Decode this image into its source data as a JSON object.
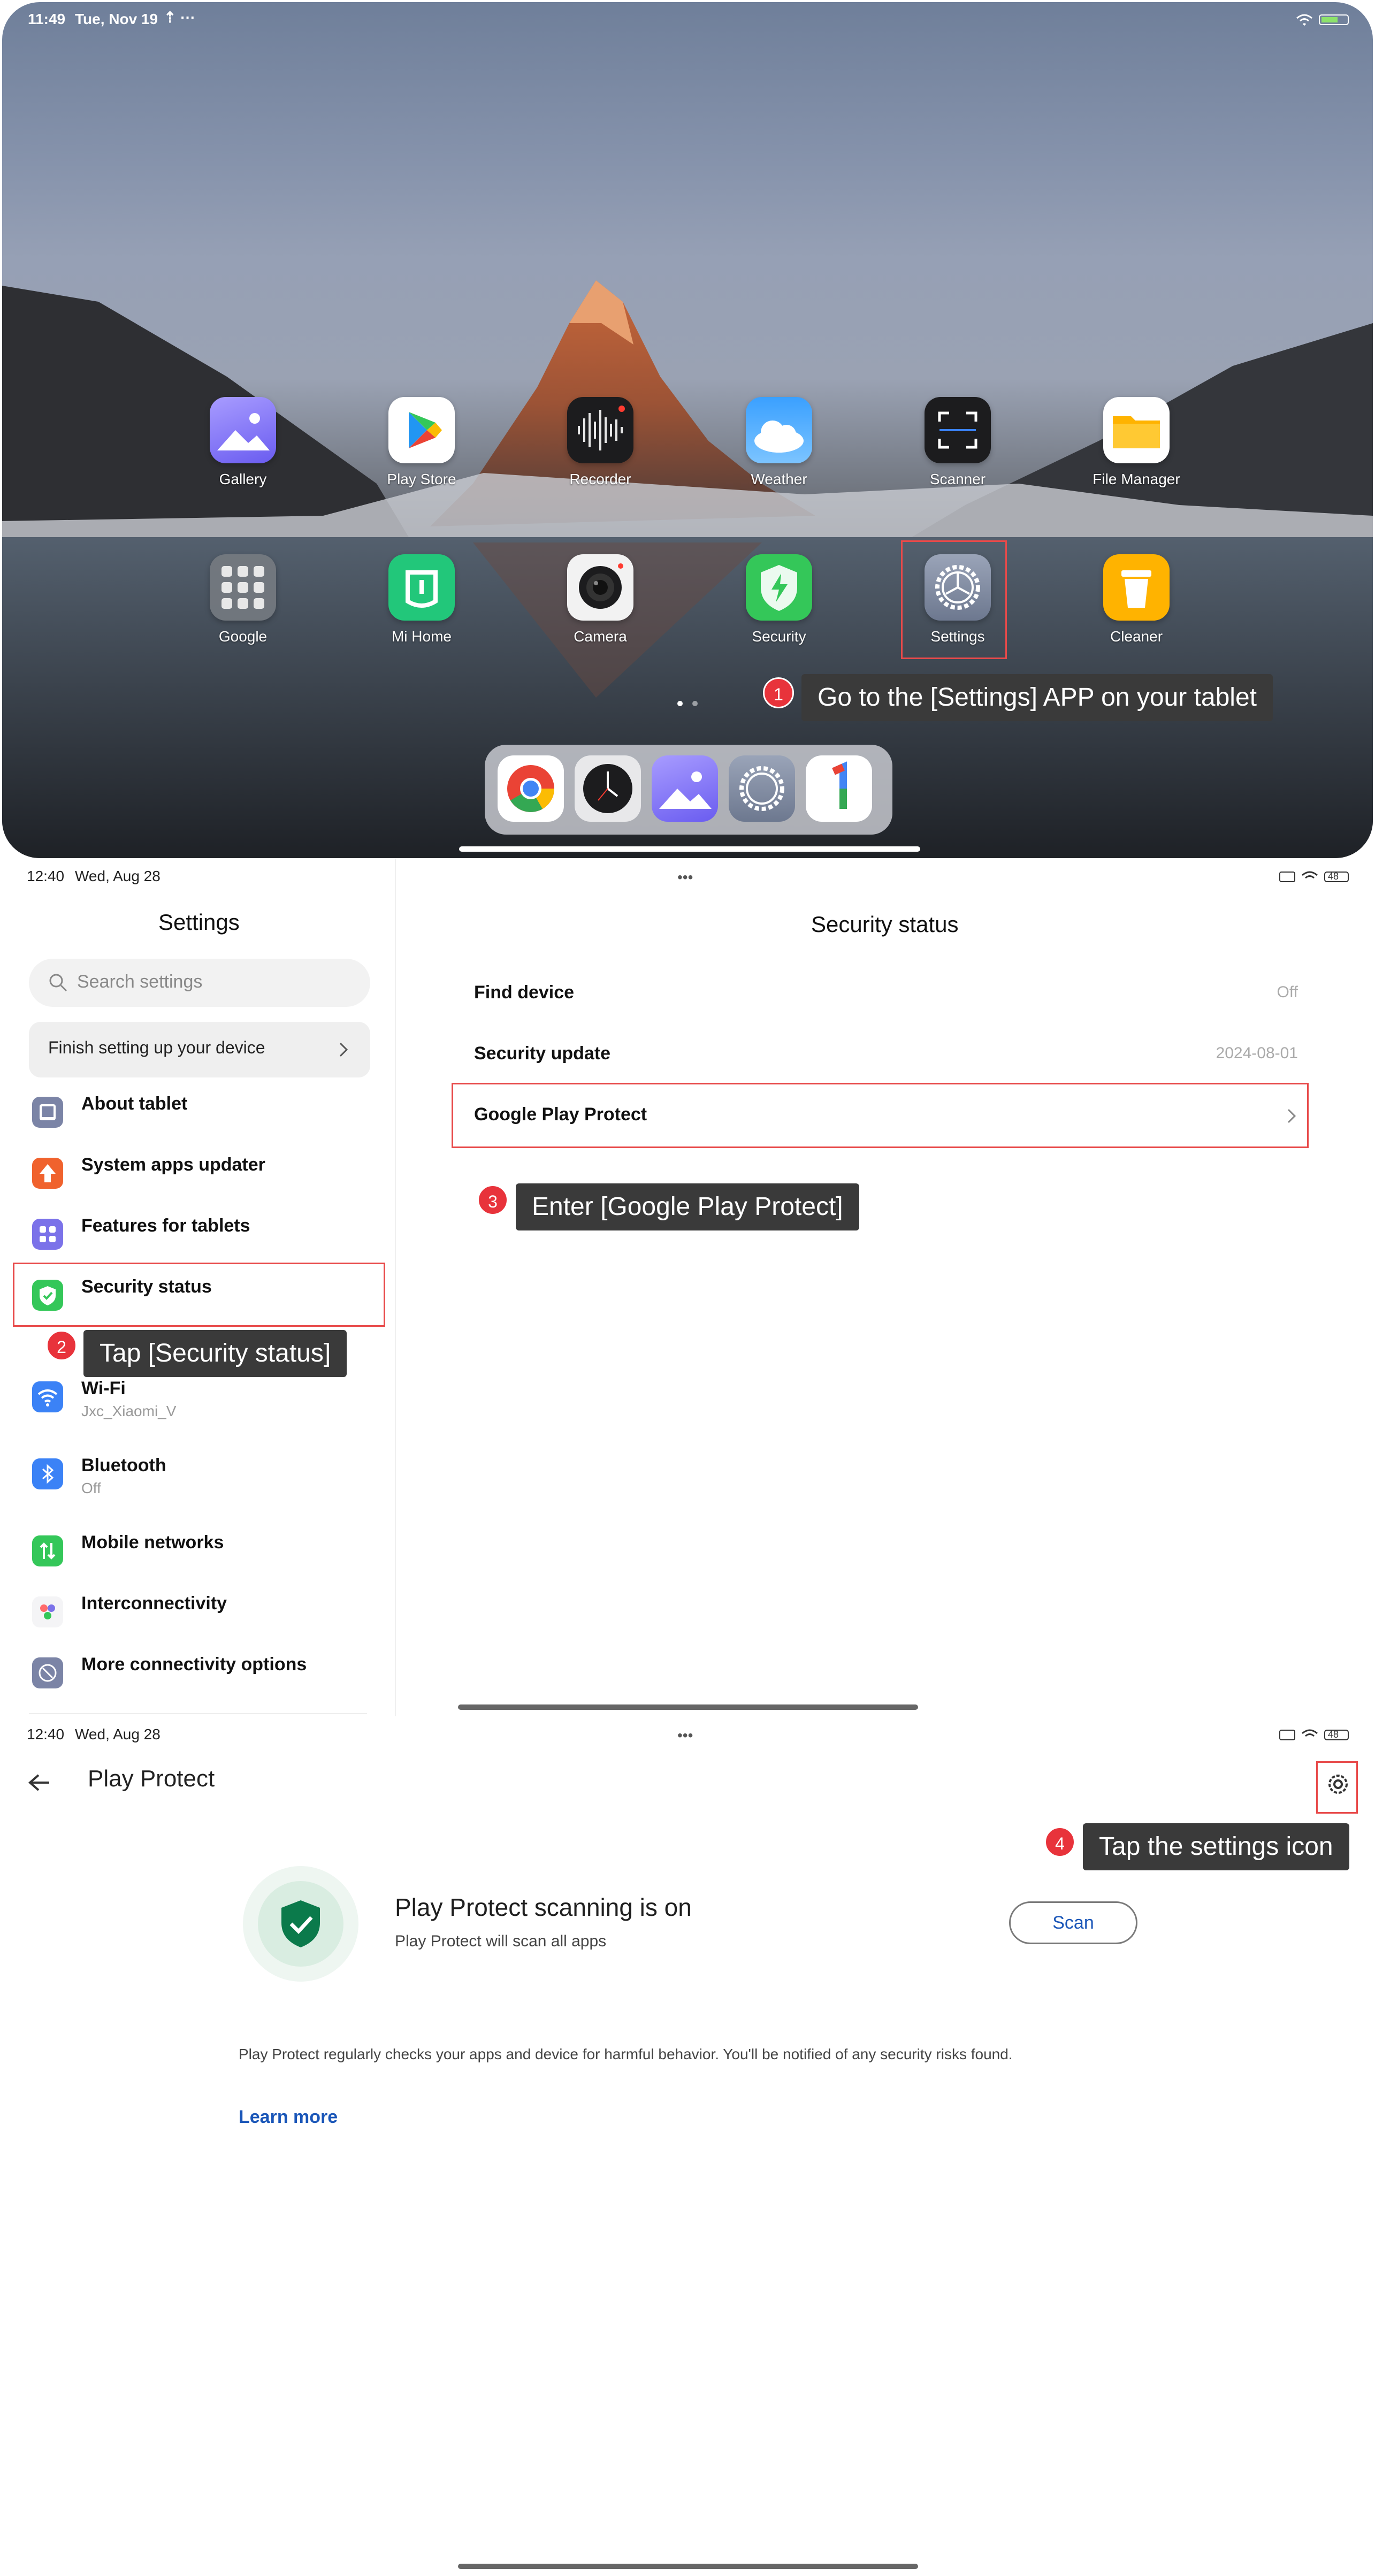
{
  "panel1": {
    "status": {
      "time": "11:49",
      "date": "Tue, Nov 19"
    },
    "apps_row1": [
      {
        "label": "Gallery",
        "icon": "gallery-icon"
      },
      {
        "label": "Play Store",
        "icon": "play-store-icon"
      },
      {
        "label": "Recorder",
        "icon": "recorder-icon"
      },
      {
        "label": "Weather",
        "icon": "weather-icon"
      },
      {
        "label": "Scanner",
        "icon": "scanner-icon"
      },
      {
        "label": "File Manager",
        "icon": "file-manager-icon"
      }
    ],
    "apps_row2": [
      {
        "label": "Google",
        "icon": "google-folder-icon"
      },
      {
        "label": "Mi Home",
        "icon": "mi-home-icon"
      },
      {
        "label": "Camera",
        "icon": "camera-icon"
      },
      {
        "label": "Security",
        "icon": "security-icon"
      },
      {
        "label": "Settings",
        "icon": "settings-icon"
      },
      {
        "label": "Cleaner",
        "icon": "cleaner-icon"
      }
    ],
    "dock": [
      "chrome-icon",
      "clock-icon",
      "gallery-icon",
      "settings-icon",
      "google-one-icon"
    ],
    "step_number": "1",
    "tip": "Go to the [Settings] APP on your tablet"
  },
  "panel2": {
    "status": {
      "time": "12:40",
      "date": "Wed, Aug 28",
      "battery": "48"
    },
    "sidebar": {
      "title": "Settings",
      "search_placeholder": "Search settings",
      "setup_banner": "Finish setting up your device",
      "items": [
        {
          "label": "About tablet",
          "sub": "",
          "icon": "tablet-icon",
          "color": "#7b84a6"
        },
        {
          "label": "System apps updater",
          "sub": "",
          "icon": "update-arrow-icon",
          "color": "#f0622d"
        },
        {
          "label": "Features for tablets",
          "sub": "",
          "icon": "grid-icon",
          "color": "#7b72e9"
        },
        {
          "label": "Security status",
          "sub": "",
          "icon": "shield-check-icon",
          "color": "#34c759"
        },
        {
          "label": "Wi-Fi",
          "sub": "Jxc_Xiaomi_V",
          "icon": "wifi-icon",
          "color": "#3b82f6"
        },
        {
          "label": "Bluetooth",
          "sub": "Off",
          "icon": "bluetooth-icon",
          "color": "#3b82f6"
        },
        {
          "label": "Mobile networks",
          "sub": "",
          "icon": "mobile-network-icon",
          "color": "#34c759"
        },
        {
          "label": "Interconnectivity",
          "sub": "",
          "icon": "interconnect-icon",
          "color": "#f4f4f6"
        },
        {
          "label": "More connectivity options",
          "sub": "",
          "icon": "link-icon",
          "color": "#7b84a6"
        }
      ]
    },
    "main": {
      "title": "Security status",
      "rows": [
        {
          "label": "Find device",
          "value": "Off"
        },
        {
          "label": "Security update",
          "value": "2024-08-01"
        },
        {
          "label": "Google Play Protect",
          "value": ""
        }
      ]
    },
    "step2": {
      "number": "2",
      "tip": "Tap [Security status]"
    },
    "step3": {
      "number": "3",
      "tip": "Enter [Google Play Protect]"
    }
  },
  "panel3": {
    "status": {
      "time": "12:40",
      "date": "Wed, Aug 28",
      "battery": "48"
    },
    "title": "Play Protect",
    "heading": "Play Protect scanning is on",
    "subheading": "Play Protect will scan all apps",
    "scan_label": "Scan",
    "description": "Play Protect regularly checks your apps and device for harmful behavior. You'll be notified of any security risks found.",
    "learn_more": "Learn more",
    "step4": {
      "number": "4",
      "tip": "Tap the settings icon"
    }
  }
}
